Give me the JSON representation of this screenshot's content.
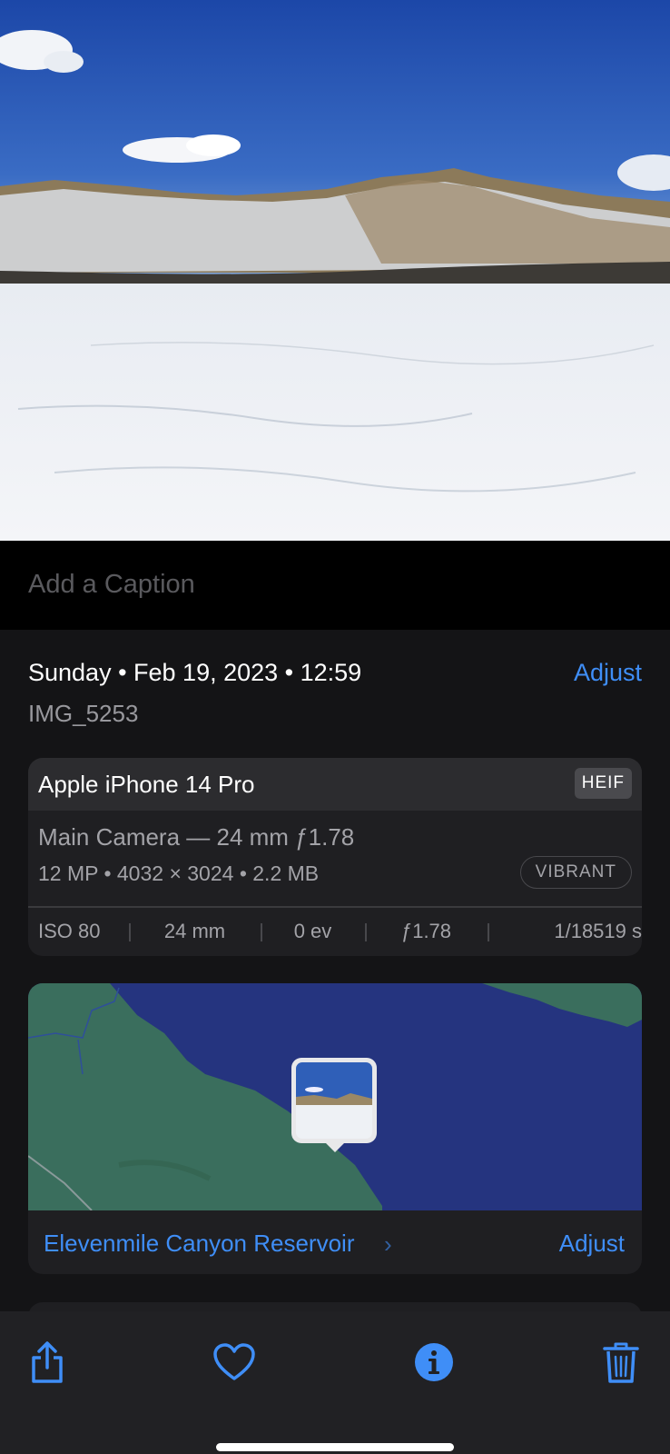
{
  "caption": {
    "placeholder": "Add a Caption",
    "value": ""
  },
  "info": {
    "date_line": "Sunday • Feb 19, 2023 • 12:59",
    "adjust_label": "Adjust",
    "filename": "IMG_5253"
  },
  "camera": {
    "model": "Apple iPhone 14 Pro",
    "format_badge": "HEIF",
    "lens": "Main Camera — 24 mm ƒ1.78",
    "specs": "12 MP  •  4032 × 3024  •  2.2 MB",
    "style_badge": "VIBRANT",
    "exif": [
      "ISO 80",
      "24 mm",
      "0 ev",
      "ƒ1.78",
      "1/18519 s"
    ]
  },
  "location": {
    "name": "Elevenmile Canyon Reservoir",
    "adjust_label": "Adjust"
  },
  "toolbar": {
    "share_icon": "share-icon",
    "favorite_icon": "heart-icon",
    "info_icon": "info-icon",
    "delete_icon": "trash-icon"
  },
  "colors": {
    "accent": "#3f8ef7",
    "background": "#141416",
    "card": "#1f1f22",
    "map_water": "#25347f",
    "map_land": "#3a6e5d"
  }
}
